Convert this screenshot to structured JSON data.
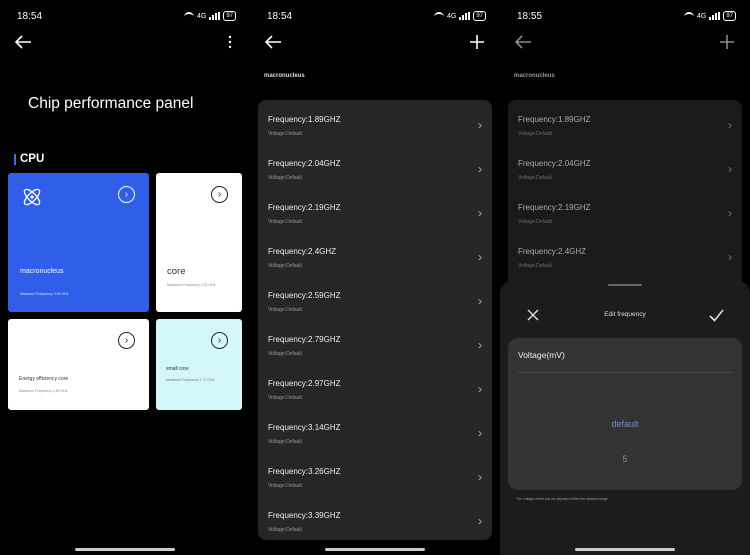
{
  "phones": [
    {
      "time": "18:54",
      "battery": "97",
      "net": "4G"
    },
    {
      "time": "18:54",
      "battery": "97",
      "net": "4G"
    },
    {
      "time": "18:55",
      "battery": "97",
      "net": "4G"
    }
  ],
  "panel": {
    "title": "Chip performance panel",
    "section": "CPU",
    "cards": [
      {
        "name": "macronucleus",
        "sub": "Maximum Frequency 3.39 GHz"
      },
      {
        "name": "core",
        "sub": "Maximum Frequency 3.20 GHz"
      },
      {
        "name": "Energy efficiency core",
        "sub": "Maximum Frequency 1.89 GHz"
      },
      {
        "name": "small core",
        "sub": "Maximum Frequency 1.77 GHz"
      }
    ],
    "card_arrow": "›"
  },
  "list_screen": {
    "heading": "macronucleus",
    "items": [
      {
        "freq": "Frequency:1.89GHZ",
        "voltage": "Voltage:Default"
      },
      {
        "freq": "Frequency:2.04GHZ",
        "voltage": "Voltage:Default"
      },
      {
        "freq": "Frequency:2.19GHZ",
        "voltage": "Voltage:Default"
      },
      {
        "freq": "Frequency:2.4GHZ",
        "voltage": "Voltage:Default"
      },
      {
        "freq": "Frequency:2.59GHZ",
        "voltage": "Voltage:Default"
      },
      {
        "freq": "Frequency:2.79GHZ",
        "voltage": "Voltage:Default"
      },
      {
        "freq": "Frequency:2.97GHZ",
        "voltage": "Voltage:Default"
      },
      {
        "freq": "Frequency:3.14GHZ",
        "voltage": "Voltage:Default"
      },
      {
        "freq": "Frequency:3.26GHZ",
        "voltage": "Voltage:Default"
      },
      {
        "freq": "Frequency:3.39GHZ",
        "voltage": "Voltage:Default"
      }
    ],
    "chevron": "›"
  },
  "edit_sheet": {
    "title": "Edit frequency",
    "field_label": "Voltage(mV)",
    "selected": "default",
    "next_option": "5",
    "note": "The voltage offset can be adjusted within the allowed range"
  },
  "colors": {
    "accent": "#2f5fe8",
    "small_core_bg": "#d3f7fb",
    "list_bg": "#262626",
    "sheet_bg": "#1c1c1c"
  }
}
